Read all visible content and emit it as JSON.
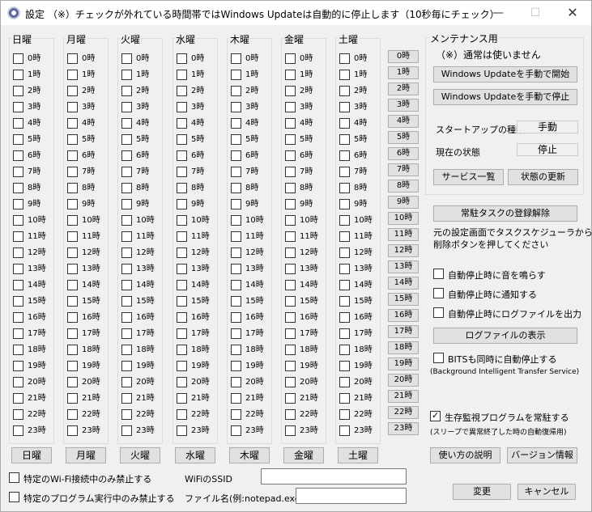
{
  "window": {
    "title": "設定 （※）チェックが外れている時間帯ではWindows Updateは自動的に停止します（10秒毎にチェック）"
  },
  "days": [
    "日曜",
    "月曜",
    "火曜",
    "水曜",
    "木曜",
    "金曜",
    "土曜"
  ],
  "hours": [
    "0時",
    "1時",
    "2時",
    "3時",
    "4時",
    "5時",
    "6時",
    "7時",
    "8時",
    "9時",
    "10時",
    "11時",
    "12時",
    "13時",
    "14時",
    "15時",
    "16時",
    "17時",
    "18時",
    "19時",
    "20時",
    "21時",
    "22時",
    "23時"
  ],
  "maintenance": {
    "label": "メンテナンス用",
    "note": "（※）通常は使いません",
    "start_button": "Windows Updateを手動で開始",
    "stop_button": "Windows Updateを手動で停止",
    "startup_type_label": "スタートアップの種類",
    "startup_type_value": "手動",
    "status_label": "現在の状態",
    "status_value": "停止",
    "services_button": "サービス一覧",
    "refresh_button": "状態の更新"
  },
  "task": {
    "unregister_button": "常駐タスクの登録解除",
    "note1": "元の設定画面でタスクスケジューラから",
    "note2": "削除ボタンを押してください"
  },
  "options": {
    "sound": "自動停止時に音を鳴らす",
    "notify": "自動停止時に通知する",
    "logfile": "自動停止時にログファイルを出力",
    "log_button": "ログファイルの表示",
    "bits": "BITSも同時に自動停止する",
    "bits_note": "(Background Intelligent Transfer Service)",
    "monitor": "生存監視プログラムを常駐する",
    "monitor_checked": true,
    "monitor_note": "(スリープで異常終了した時の自動復帰用)"
  },
  "footer": {
    "wifi_only": "特定のWi-Fi接続中のみ禁止する",
    "program_only": "特定のプログラム実行中のみ禁止する",
    "wifi_ssid_label": "WiFiのSSID",
    "filename_label": "ファイル名(例:notepad.exe)",
    "wifi_ssid_value": "",
    "filename_value": "",
    "help_button": "使い方の説明",
    "version_button": "バージョン情報",
    "ok_button": "変更",
    "cancel_button": "キャンセル"
  }
}
